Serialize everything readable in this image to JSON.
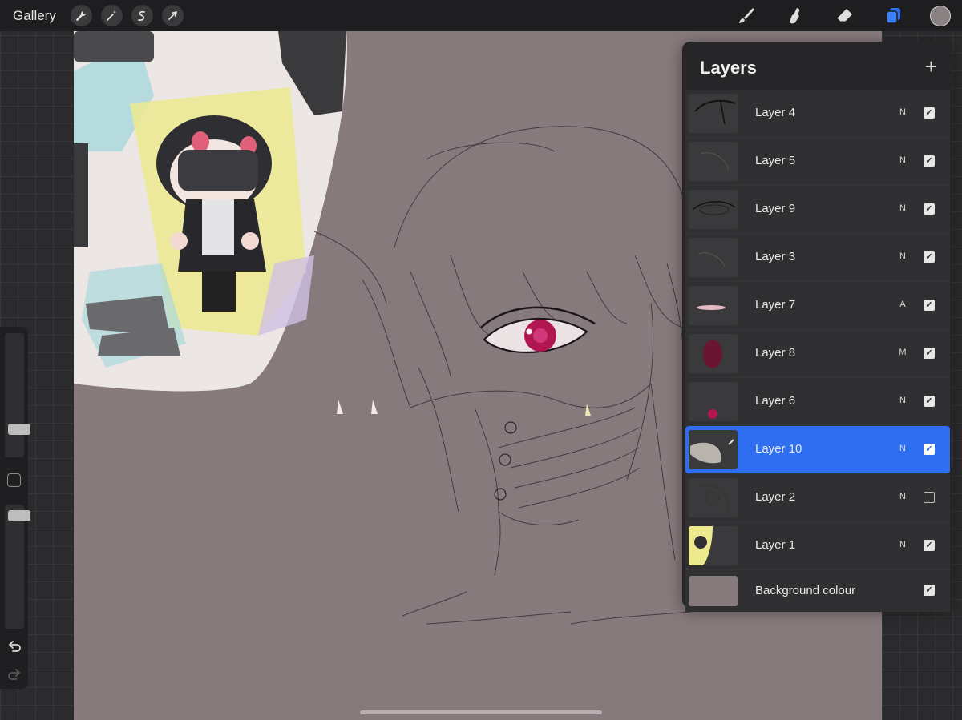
{
  "topbar": {
    "gallery_label": "Gallery",
    "left_tools": [
      "wrench-icon",
      "magic-wand-icon",
      "selection-icon",
      "transform-arrow-icon"
    ],
    "right_tools": [
      "brush-icon",
      "smudge-icon",
      "eraser-icon",
      "layers-icon"
    ],
    "active_color": "#8a8183",
    "accent": "#2f6ef0"
  },
  "sidebar": {
    "brush_size": 0.2,
    "opacity": 0.95
  },
  "layers_panel": {
    "title": "Layers",
    "add_icon": "plus-icon",
    "layers": [
      {
        "name": "Layer 4",
        "blend": "N",
        "visible": true
      },
      {
        "name": "Layer 5",
        "blend": "N",
        "visible": true
      },
      {
        "name": "Layer 9",
        "blend": "N",
        "visible": true
      },
      {
        "name": "Layer 3",
        "blend": "N",
        "visible": true
      },
      {
        "name": "Layer 7",
        "blend": "A",
        "visible": true
      },
      {
        "name": "Layer 8",
        "blend": "M",
        "visible": true
      },
      {
        "name": "Layer 6",
        "blend": "N",
        "visible": true
      },
      {
        "name": "Layer 10",
        "blend": "N",
        "visible": true,
        "selected": true
      },
      {
        "name": "Layer 2",
        "blend": "N",
        "visible": false
      },
      {
        "name": "Layer 1",
        "blend": "N",
        "visible": true
      }
    ],
    "background": {
      "name": "Background colour",
      "visible": true,
      "color": "#877a7c"
    }
  }
}
